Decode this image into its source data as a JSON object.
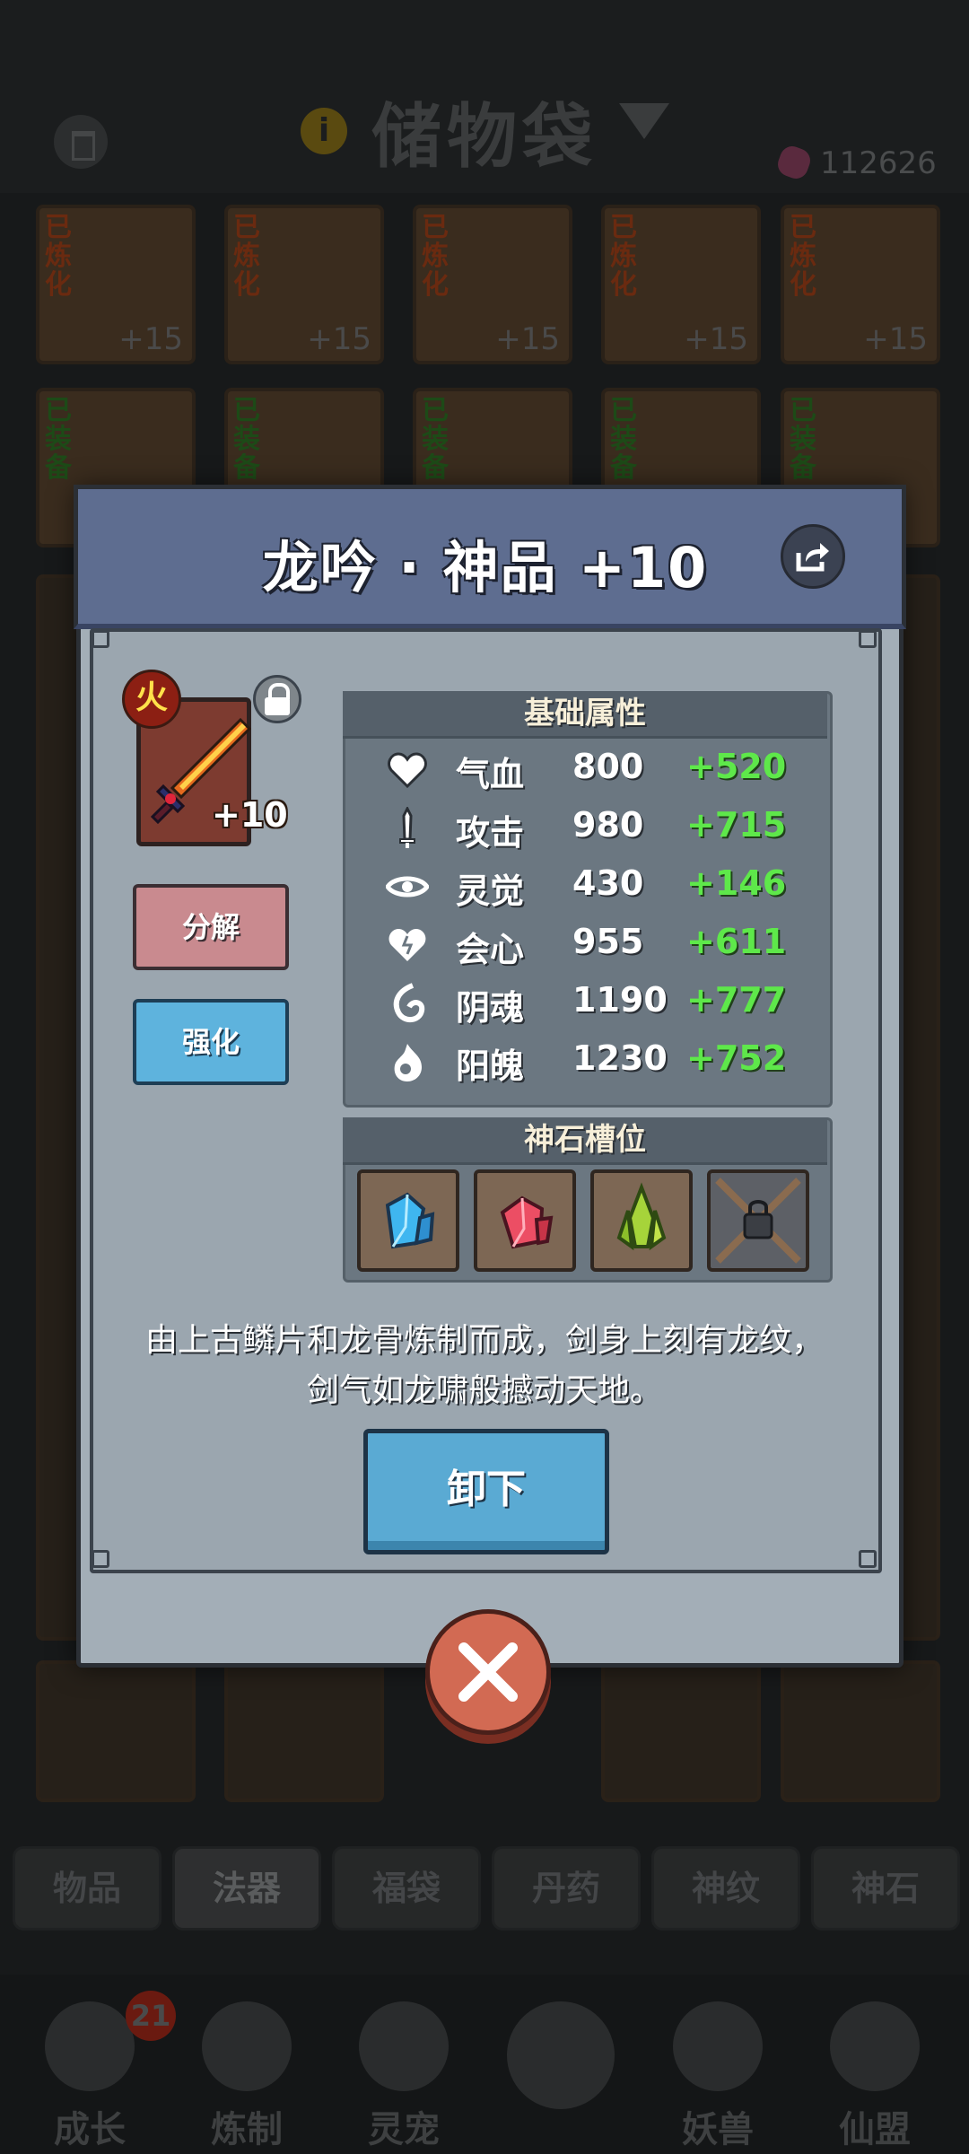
{
  "background": {
    "title": "储物袋",
    "currency_value": "112626",
    "grid_row1_tags": [
      "已炼化",
      "已炼化",
      "已炼化",
      "已炼化",
      "已炼化"
    ],
    "grid_row1_levels": [
      "+15",
      "+15",
      "+15",
      "+15",
      "+15"
    ],
    "grid_row2_tags": [
      "已装备",
      "已装备",
      "已装备",
      "已装备",
      "已装备"
    ],
    "bottom_tabs": [
      "物品",
      "法器",
      "福袋",
      "丹药",
      "神纹",
      "神石"
    ],
    "active_tab": "法器",
    "nav": [
      {
        "label": "成长",
        "badge": "21"
      },
      {
        "label": "炼制"
      },
      {
        "label": "灵宠"
      },
      {
        "label": ""
      },
      {
        "label": "妖兽"
      },
      {
        "label": "仙盟"
      }
    ]
  },
  "modal": {
    "title": "龙吟 · 神品 +10",
    "item": {
      "element_badge": "火",
      "level": "+10"
    },
    "buttons": {
      "decompose": "分解",
      "enhance": "强化",
      "unequip": "卸下"
    },
    "stats_title": "基础属性",
    "stats": [
      {
        "icon": "heart-icon",
        "name": "气血",
        "value": "800",
        "bonus": "+520"
      },
      {
        "icon": "sword-icon",
        "name": "攻击",
        "value": "980",
        "bonus": "+715"
      },
      {
        "icon": "spirit-eye-icon",
        "name": "灵觉",
        "value": "430",
        "bonus": "+146"
      },
      {
        "icon": "crit-heart-icon",
        "name": "会心",
        "value": "955",
        "bonus": "+611"
      },
      {
        "icon": "yin-soul-icon",
        "name": "阴魂",
        "value": "1190",
        "bonus": "+777"
      },
      {
        "icon": "yang-soul-icon",
        "name": "阳魄",
        "value": "1230",
        "bonus": "+752"
      }
    ],
    "gems_title": "神石槽位",
    "gems": [
      {
        "icon": "blue-crystal-icon",
        "color": "#3fb6f0"
      },
      {
        "icon": "red-crystal-icon",
        "color": "#ec4e64"
      },
      {
        "icon": "green-crystal-icon",
        "color": "#a6d43a"
      },
      {
        "icon": "locked-chain-icon",
        "color": "#5d6066"
      }
    ],
    "description": "由上古鳞片和龙骨炼制而成，剑身上刻有龙纹，剑气如龙啸般撼动天地。"
  },
  "colors": {
    "header": "#5e6d90",
    "panel": "#a3aeb7",
    "bonus_green": "#5ee84a",
    "decompose": "#c98a8f",
    "enhance": "#5eb3dd",
    "close": "#d26a53"
  }
}
